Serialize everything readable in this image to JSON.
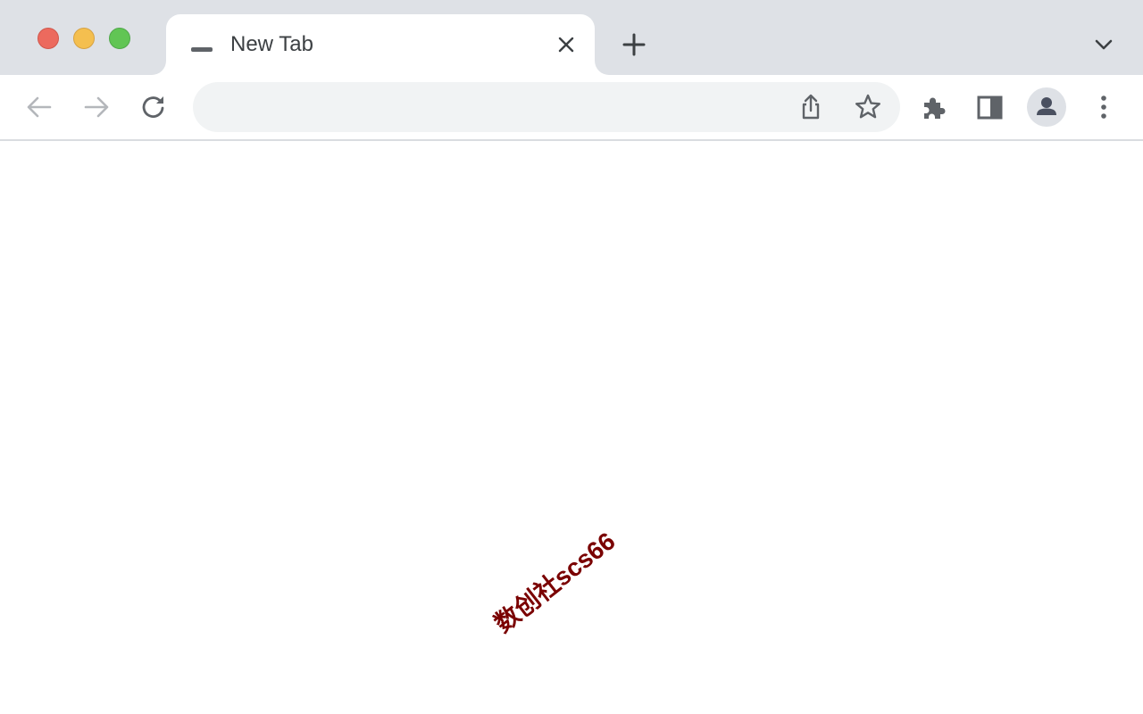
{
  "window": {
    "controls": [
      "close",
      "minimize",
      "zoom"
    ],
    "colors": {
      "close": "#ec6a5e",
      "minimize": "#f4bf4f",
      "zoom": "#61c554"
    }
  },
  "tabs": [
    {
      "title": "New Tab",
      "active": true,
      "favicon": "new-tab-favicon",
      "close_icon": "close-icon"
    }
  ],
  "tabstrip": {
    "new_tab_icon": "plus-icon",
    "tab_search_icon": "chevron-down-icon"
  },
  "toolbar": {
    "back": {
      "icon": "back-arrow-icon",
      "enabled": false
    },
    "forward": {
      "icon": "forward-arrow-icon",
      "enabled": false
    },
    "reload": {
      "icon": "reload-icon",
      "enabled": true
    },
    "omnibox": {
      "value": "",
      "placeholder": ""
    },
    "omnibox_actions": [
      "share-icon",
      "bookmark-star-icon"
    ],
    "extensions_icon": "puzzle-icon",
    "side_panel_icon": "side-panel-icon",
    "profile_icon": "profile-avatar-icon",
    "menu_icon": "kebab-menu-icon"
  },
  "content": {
    "watermark": "数创社scs66"
  },
  "colors": {
    "tabstrip_bg": "#dee1e6",
    "omnibox_bg": "#f1f3f4",
    "icon": "#5f6368",
    "watermark": "#7a0000"
  }
}
